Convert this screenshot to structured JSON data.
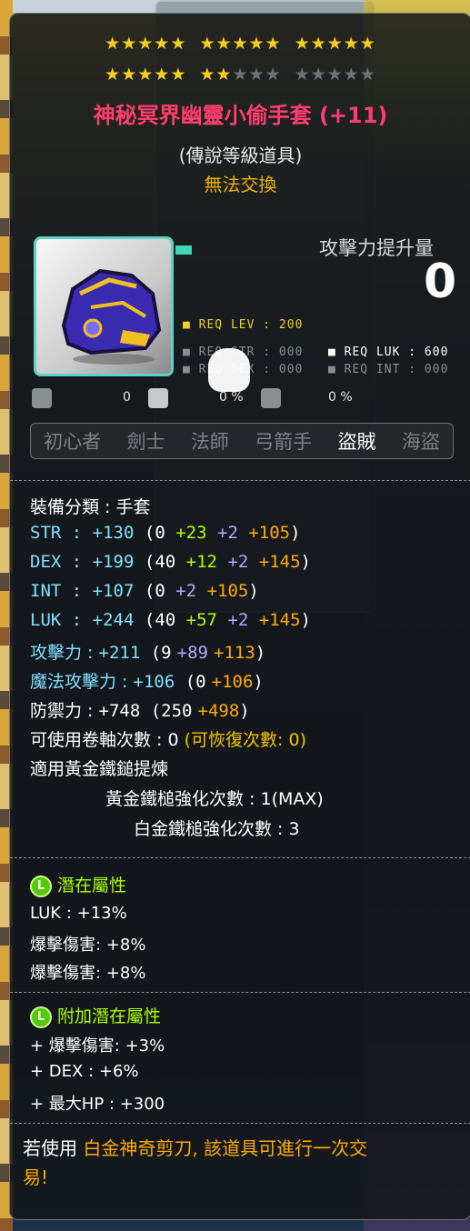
{
  "stars": {
    "row1_on": 15,
    "row1_off": 0,
    "row2_on": 7,
    "row2_off": 8
  },
  "item": {
    "name": "神秘冥界幽靈小偷手套 (+11)",
    "grade": "(傳說等級道具)",
    "tradable": "無法交換",
    "icon": "gloves-icon"
  },
  "attack_increase": {
    "label": "攻擊力提升量",
    "value": "0"
  },
  "requirements": {
    "lev": "■ REQ LEV : 200",
    "str": "■ REQ STR : 000",
    "dex": "■ REQ DEX : 000",
    "luk": "■ REQ LUK : 600",
    "int": "■ REQ INT : 000"
  },
  "small_stats": {
    "v1": "0",
    "v2": "0 %",
    "v3": "0 %"
  },
  "jobs": [
    {
      "label": "初心者",
      "active": false
    },
    {
      "label": "劍士",
      "active": false
    },
    {
      "label": "法師",
      "active": false
    },
    {
      "label": "弓箭手",
      "active": false
    },
    {
      "label": "盜賊",
      "active": true
    },
    {
      "label": "海盜",
      "active": false
    }
  ],
  "category": "裝備分類 : 手套",
  "stats": {
    "str": {
      "name": "STR",
      "total": "+130",
      "base": "0",
      "flame": "+23",
      "scroll": "+2",
      "star": "+105"
    },
    "dex": {
      "name": "DEX",
      "total": "+199",
      "base": "40",
      "flame": "+12",
      "scroll": "+2",
      "star": "+145"
    },
    "int": {
      "name": "INT",
      "total": "+107",
      "base": "0",
      "scroll": "+2",
      "star": "+105"
    },
    "luk": {
      "name": "LUK",
      "total": "+244",
      "base": "40",
      "flame": "+57",
      "scroll": "+2",
      "star": "+145"
    },
    "atk": {
      "name": "攻擊力",
      "total": "+211",
      "base": "9",
      "scroll": "+89",
      "star": "+113"
    },
    "matk": {
      "name": "魔法攻擊力",
      "total": "+106",
      "base": "0",
      "star": "+106"
    },
    "def": {
      "name": "防禦力",
      "total": "+748",
      "base": "250",
      "star": "+498"
    }
  },
  "upgrades": {
    "slots": "可使用卷軸次數 : 0",
    "recover": "(可恢復次數: 0)",
    "golden": "適用黃金鐵鎚提煉",
    "golden_count": "黃金鐵槌強化次數 : 1(MAX)",
    "platinum_count": "白金鐵槌強化次數 : 3"
  },
  "potential": {
    "badge": "L",
    "title": "潛在屬性",
    "lines": [
      "LUK : +13%",
      "爆擊傷害: +8%",
      "爆擊傷害: +8%"
    ]
  },
  "bonus_potential": {
    "badge": "L",
    "title": "附加潛在屬性",
    "lines": [
      "+ 爆擊傷害: +3%",
      "+ DEX : +6%",
      "+ 最大HP : +300"
    ]
  },
  "footer": {
    "prefix": "若使用",
    "highlight_1": "白金神奇剪刀, 該道具可進行一次交",
    "highlight_2": "易!"
  },
  "colors": {
    "title": "#ff3d6f",
    "star_on": "#f4cf1c",
    "cyan": "#7fe0ff",
    "green": "#aaff00",
    "purple": "#b7a6ff",
    "orange": "#ffaa00"
  }
}
